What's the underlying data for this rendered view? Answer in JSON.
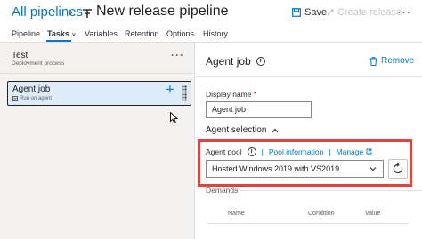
{
  "header": {
    "breadcrumb": "All pipelines",
    "separator": "›",
    "title": "New release pipeline",
    "save_label": "Save",
    "create_release_label": "Create release",
    "more": "···"
  },
  "tabs": [
    {
      "label": "Pipeline",
      "active": false
    },
    {
      "label": "Tasks",
      "active": true,
      "chevron": "∨"
    },
    {
      "label": "Variables",
      "active": false
    },
    {
      "label": "Retention",
      "active": false
    },
    {
      "label": "Options",
      "active": false
    },
    {
      "label": "History",
      "active": false
    }
  ],
  "stage": {
    "name": "Test",
    "subtitle": "Deployment process",
    "more": "···"
  },
  "job": {
    "name": "Agent job",
    "subtitle": "Run on agent",
    "add": "+"
  },
  "details": {
    "title": "Agent job",
    "info": "i",
    "remove_label": "Remove",
    "display_name_label": "Display name",
    "required_mark": "*",
    "display_name_value": "Agent job",
    "agent_selection_label": "Agent selection",
    "agent_pool_label": "Agent pool",
    "pool_info_link": "Pool information",
    "manage_link": "Manage",
    "divider": "|",
    "agent_pool_value": "Hosted Windows 2019 with VS2019",
    "demands_label": "Demands",
    "columns": [
      "Name",
      "Condition",
      "Value"
    ]
  },
  "colors": {
    "accent": "#0078d4",
    "highlight": "#e0443a",
    "selected_bg": "#deecf9",
    "left_panel_bg": "#f3f2f1"
  }
}
